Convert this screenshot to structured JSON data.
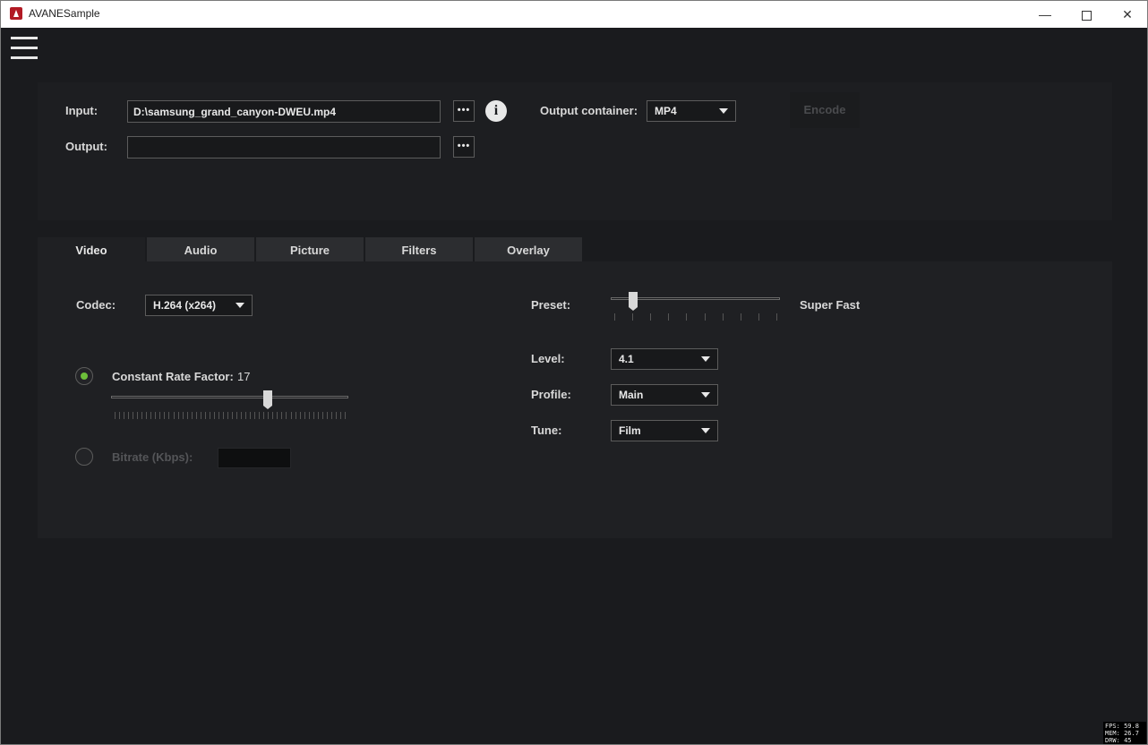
{
  "window": {
    "title": "AVANESample",
    "minimize": "—",
    "close": "✕"
  },
  "io": {
    "input_label": "Input:",
    "input_value": "D:\\samsung_grand_canyon-DWEU.mp4",
    "output_label": "Output:",
    "output_value": "",
    "browse": "•••",
    "info": "i",
    "container_label": "Output container:",
    "container_value": "MP4",
    "encode_label": "Encode"
  },
  "tabs": [
    {
      "label": "Video",
      "active": true
    },
    {
      "label": "Audio",
      "active": false
    },
    {
      "label": "Picture",
      "active": false
    },
    {
      "label": "Filters",
      "active": false
    },
    {
      "label": "Overlay",
      "active": false
    }
  ],
  "video": {
    "codec_label": "Codec:",
    "codec_value": "H.264 (x264)",
    "crf_label": "Constant Rate Factor:",
    "crf_value": "17",
    "crf_selected": true,
    "bitrate_label": "Bitrate (Kbps):",
    "bitrate_value": "",
    "preset_label": "Preset:",
    "preset_value": "Super Fast",
    "level_label": "Level:",
    "level_value": "4.1",
    "profile_label": "Profile:",
    "profile_value": "Main",
    "tune_label": "Tune:",
    "tune_value": "Film"
  },
  "stats": {
    "fps": "FPS: 59.8",
    "mem": "MEM: 26.7",
    "drw": "DRW: 45"
  },
  "colors": {
    "accent_radio": "#6cbf3a",
    "background": "#1a1b1e",
    "panel": "#1f2023"
  }
}
